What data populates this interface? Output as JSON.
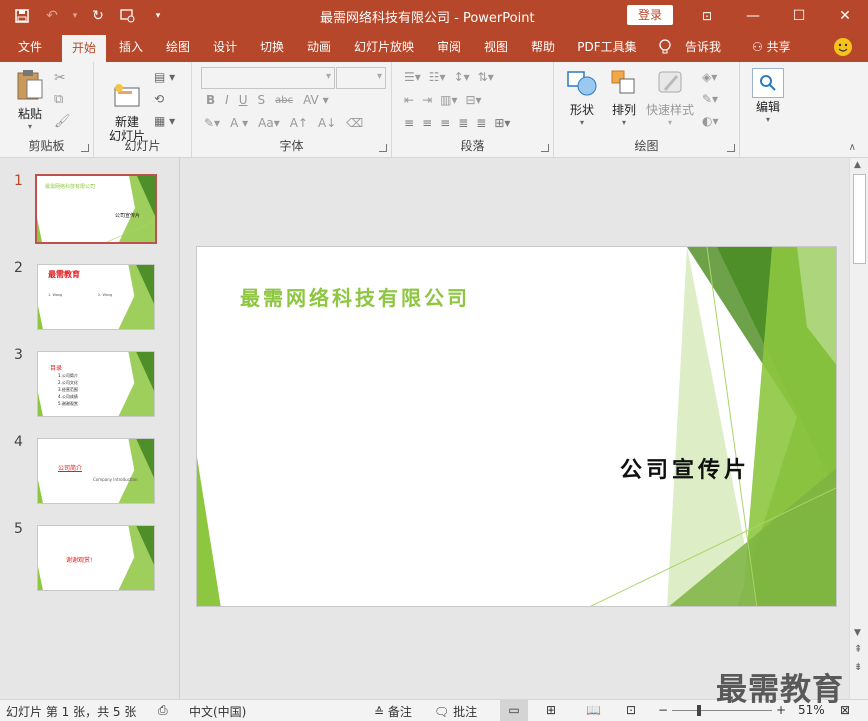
{
  "window": {
    "title": "最需网络科技有限公司  -  PowerPoint",
    "login_label": "登录",
    "minimize": "—",
    "restore": "⧉",
    "maximize": "☐",
    "close": "✕"
  },
  "tabs": [
    {
      "label": "文件"
    },
    {
      "label": "开始"
    },
    {
      "label": "插入"
    },
    {
      "label": "绘图"
    },
    {
      "label": "设计"
    },
    {
      "label": "切换"
    },
    {
      "label": "动画"
    },
    {
      "label": "幻灯片放映"
    },
    {
      "label": "审阅"
    },
    {
      "label": "视图"
    },
    {
      "label": "帮助"
    },
    {
      "label": "PDF工具集"
    },
    {
      "label": "告诉我"
    }
  ],
  "share_label": "共享",
  "ribbon": {
    "clipboard": {
      "paste_label": "粘贴",
      "group_label": "剪贴板"
    },
    "slides": {
      "new_slide_label": "新建\n幻灯片",
      "group_label": "幻灯片"
    },
    "font": {
      "group_label": "字体",
      "font_name": "",
      "font_size": ""
    },
    "paragraph": {
      "group_label": "段落"
    },
    "drawing": {
      "shapes_label": "形状",
      "arrange_label": "排列",
      "quick_styles_label": "快速样式",
      "group_label": "绘图"
    },
    "editing": {
      "edit_label": "编辑"
    }
  },
  "thumbnails": [
    {
      "number": "1",
      "title": "最需网络科技有限公司",
      "subtitle": "公司宣传片"
    },
    {
      "number": "2",
      "title": "最需教育",
      "items": [
        "1. Wang",
        "2. Wang"
      ]
    },
    {
      "number": "3",
      "title": "目录",
      "items": [
        "1.公司简介",
        "2.公司文化",
        "3.经营范围",
        "4.公司成绩",
        "5.谢谢观赏"
      ]
    },
    {
      "number": "4",
      "title": "公司简介",
      "subtitle": "Company Introduction"
    },
    {
      "number": "5",
      "title": "谢谢观赏!"
    }
  ],
  "slide": {
    "company_name": "最需网络科技有限公司",
    "promo_title": "公司宣传片"
  },
  "status": {
    "slide_info": "幻灯片 第 1 张，共 5 张",
    "language": "中文(中国)",
    "notes_label": "备注",
    "comments_label": "批注",
    "zoom": "51%",
    "minus": "−",
    "plus": "+"
  },
  "watermark": "最需教育",
  "colors": {
    "accent": "#b7472a",
    "green_light": "#8dc63f",
    "green_dark": "#4e8f2a",
    "selection": "#c0504d"
  }
}
